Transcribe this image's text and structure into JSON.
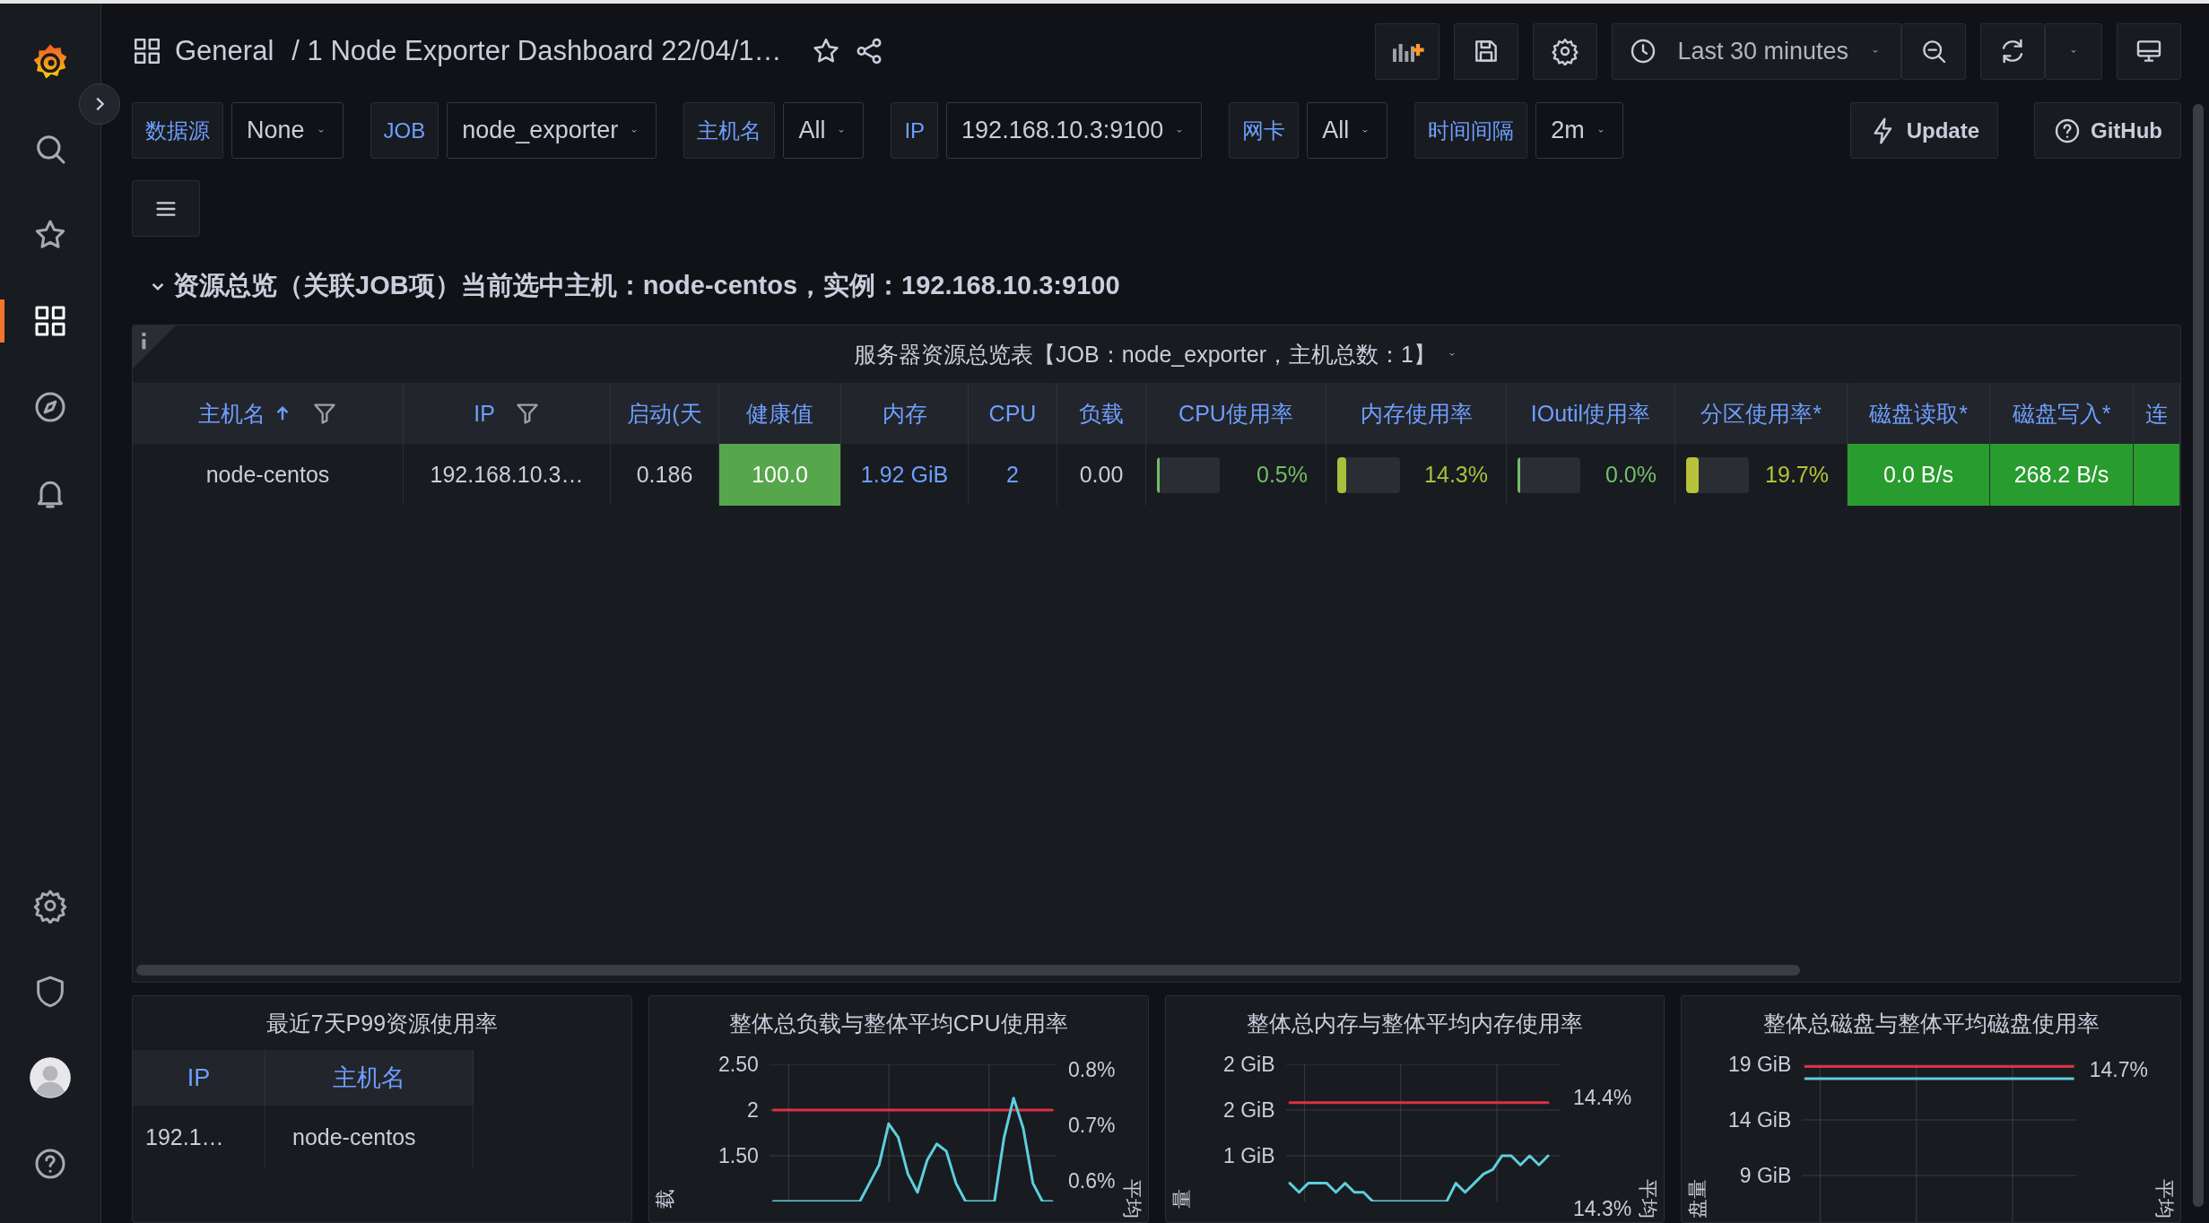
{
  "sidebar": {
    "items": [
      {
        "kind": "search",
        "selected": false
      },
      {
        "kind": "starred",
        "selected": false
      },
      {
        "kind": "dashboards",
        "selected": true
      },
      {
        "kind": "explore",
        "selected": false
      },
      {
        "kind": "alerting",
        "selected": false
      }
    ],
    "bottom_items": [
      {
        "kind": "configuration",
        "selected": false
      },
      {
        "kind": "admin",
        "selected": false
      },
      {
        "kind": "profile",
        "selected": false
      },
      {
        "kind": "help",
        "selected": false
      }
    ]
  },
  "topbar": {
    "folder": "General",
    "title": "/ 1 Node Exporter Dashboard 22/04/1…",
    "time_range": "Last 30 minutes"
  },
  "variables": [
    {
      "label": "数据源",
      "value": "None"
    },
    {
      "label": "JOB",
      "value": "node_exporter"
    },
    {
      "label": "主机名",
      "value": "All"
    },
    {
      "label": "IP",
      "value": "192.168.10.3:9100"
    },
    {
      "label": "网卡",
      "value": "All"
    },
    {
      "label": "时间间隔",
      "value": "2m"
    }
  ],
  "links": [
    {
      "label": "Update",
      "kind": "action"
    },
    {
      "label": "GitHub",
      "kind": "help"
    }
  ],
  "row": {
    "title": "资源总览（关联JOB项）当前选中主机：node-centos，实例：192.168.10.3:9100",
    "expanded": true
  },
  "panel": {
    "title": "服务器资源总览表【JOB：node_exporter，主机总数：1】",
    "columns": [
      {
        "label": "主机名",
        "sorted": true,
        "filterable": true
      },
      {
        "label": "IP",
        "sorted": false,
        "filterable": true
      },
      {
        "label": "启动(天",
        "sorted": false,
        "filterable": false
      },
      {
        "label": "健康值",
        "sorted": false,
        "filterable": false
      },
      {
        "label": "内存",
        "sorted": false,
        "filterable": false
      },
      {
        "label": "CPU",
        "sorted": false,
        "filterable": false
      },
      {
        "label": "负载",
        "sorted": false,
        "filterable": false
      },
      {
        "label": "CPU使用率",
        "sorted": false,
        "filterable": false
      },
      {
        "label": "内存使用率",
        "sorted": false,
        "filterable": false
      },
      {
        "label": "IOutil使用率",
        "sorted": false,
        "filterable": false
      },
      {
        "label": "分区使用率*",
        "sorted": false,
        "filterable": false
      },
      {
        "label": "磁盘读取*",
        "sorted": false,
        "filterable": false
      },
      {
        "label": "磁盘写入*",
        "sorted": false,
        "filterable": false
      },
      {
        "label": "连",
        "sorted": false,
        "filterable": false
      }
    ],
    "rows": [
      {
        "cells": [
          {
            "kind": "text",
            "text": "node-centos"
          },
          {
            "kind": "text",
            "text": "192.168.10.3…"
          },
          {
            "kind": "text",
            "text": "0.186"
          },
          {
            "kind": "background",
            "text": "100.0",
            "color": "#56a64b"
          },
          {
            "kind": "colored",
            "text": "1.92 GiB",
            "color": "#6e9fff"
          },
          {
            "kind": "colored",
            "text": "2",
            "color": "#6e9fff"
          },
          {
            "kind": "text",
            "text": "0.00"
          },
          {
            "kind": "gauge",
            "text": "0.5%",
            "level": 0.005,
            "color": "#73bf69"
          },
          {
            "kind": "gauge",
            "text": "14.3%",
            "level": 0.143,
            "color": "#a6c13d"
          },
          {
            "kind": "gauge",
            "text": "0.0%",
            "level": 0.0,
            "color": "#73bf69"
          },
          {
            "kind": "gauge",
            "text": "19.7%",
            "level": 0.197,
            "color": "#b7c23a"
          },
          {
            "kind": "background",
            "text": "0.0 B/s",
            "color": "#299c2f"
          },
          {
            "kind": "background",
            "text": "268.2 B/s",
            "color": "#299c2f"
          },
          {
            "kind": "background",
            "color": "#299c2f"
          }
        ]
      }
    ]
  },
  "p99_panel": {
    "title": "最近7天P99资源使用率",
    "columns": [
      "IP",
      "主机名"
    ],
    "rows": [
      [
        "192.1…",
        "node-centos"
      ]
    ]
  },
  "charts": [
    {
      "title": "整体总负载与整体平均CPU使用率",
      "left_label": "载",
      "right_label": "平均",
      "right_ticks": [
        "0.8%",
        "0.7%",
        "0.6%"
      ],
      "chart_data": {
        "type": "line",
        "grid": true,
        "ylim": [
          1,
          2.5
        ],
        "yticks": [
          {
            "value": 2.5,
            "label": "2.50"
          },
          {
            "value": 2,
            "label": "2"
          },
          {
            "value": 1.5,
            "label": "1.50"
          }
        ],
        "series": [
          {
            "color": "#e02f44",
            "values": [
              2,
              2,
              2,
              2,
              2,
              2,
              2,
              2,
              2,
              2,
              2,
              2,
              2,
              2,
              2,
              2,
              2,
              2,
              2,
              2,
              2,
              2,
              2,
              2,
              2,
              2,
              2,
              2,
              2,
              2
            ]
          },
          {
            "color": "#5ecede",
            "values": [
              1,
              1,
              1,
              1,
              1,
              1,
              1,
              1,
              1,
              1,
              1.2,
              1.4,
              1.85,
              1.7,
              1.3,
              1.1,
              1.45,
              1.63,
              1.55,
              1.2,
              1,
              1,
              1,
              1,
              1.7,
              2.13,
              1.8,
              1.2,
              1,
              1
            ]
          }
        ]
      }
    },
    {
      "title": "整体总内存与整体平均内存使用率",
      "left_label": "量",
      "right_label": "平均",
      "right_ticks": [
        "14.4%",
        "14.3%"
      ],
      "chart_data": {
        "type": "line",
        "grid": true,
        "ylim": [
          1,
          2.5
        ],
        "yticks": [
          {
            "value": 2.5,
            "label": "2 GiB"
          },
          {
            "value": 2,
            "label": "2 GiB"
          },
          {
            "value": 1.5,
            "label": "1 GiB"
          }
        ],
        "series": [
          {
            "color": "#e02f44",
            "values": [
              2.08,
              2.08,
              2.08,
              2.08,
              2.08,
              2.08,
              2.08,
              2.08,
              2.08,
              2.08,
              2.08,
              2.08,
              2.08,
              2.08,
              2.08,
              2.08,
              2.08,
              2.08,
              2.08,
              2.08,
              2.08,
              2.08,
              2.08,
              2.08,
              2.08,
              2.08,
              2.08,
              2.08,
              2.08,
              null
            ]
          },
          {
            "color": "#5ecede",
            "values": [
              1.2,
              1.1,
              1.2,
              1.2,
              1.2,
              1.1,
              1.2,
              1.1,
              1.1,
              1,
              1,
              1,
              1,
              1,
              1,
              1,
              1,
              1,
              1.2,
              1.1,
              1.2,
              1.3,
              1.35,
              1.5,
              1.5,
              1.4,
              1.5,
              1.4,
              1.5,
              null
            ]
          }
        ]
      }
    },
    {
      "title": "整体总磁盘与整体平均磁盘使用率",
      "left_label": "盘量",
      "right_label": "平均",
      "right_ticks": [
        "14.7%"
      ],
      "chart_data": {
        "type": "line",
        "grid": true,
        "ylim": [
          4,
          19
        ],
        "yticks": [
          {
            "value": 19,
            "label": "19 GiB"
          },
          {
            "value": 14,
            "label": "14 GiB"
          },
          {
            "value": 9,
            "label": "9 GiB"
          }
        ],
        "series": [
          {
            "color": "#e02f44",
            "values": [
              18.8,
              18.8,
              18.8,
              18.8,
              18.8,
              18.8,
              18.8,
              18.8,
              18.8,
              18.8,
              18.8,
              18.8,
              18.8,
              18.8,
              18.8,
              18.8,
              18.8,
              18.8,
              18.8,
              18.8,
              18.8,
              18.8,
              18.8,
              18.8,
              18.8,
              18.8,
              18.8,
              18.8,
              18.8,
              18.8
            ]
          },
          {
            "color": "#5ecede",
            "values": [
              17.7,
              17.7,
              17.7,
              17.7,
              17.7,
              17.7,
              17.7,
              17.7,
              17.7,
              17.7,
              17.7,
              17.7,
              17.7,
              17.7,
              17.7,
              17.7,
              17.7,
              17.7,
              17.7,
              17.7,
              17.7,
              17.7,
              17.7,
              17.7,
              17.7,
              17.7,
              17.7,
              17.7,
              17.7,
              17.7
            ]
          }
        ]
      }
    }
  ]
}
